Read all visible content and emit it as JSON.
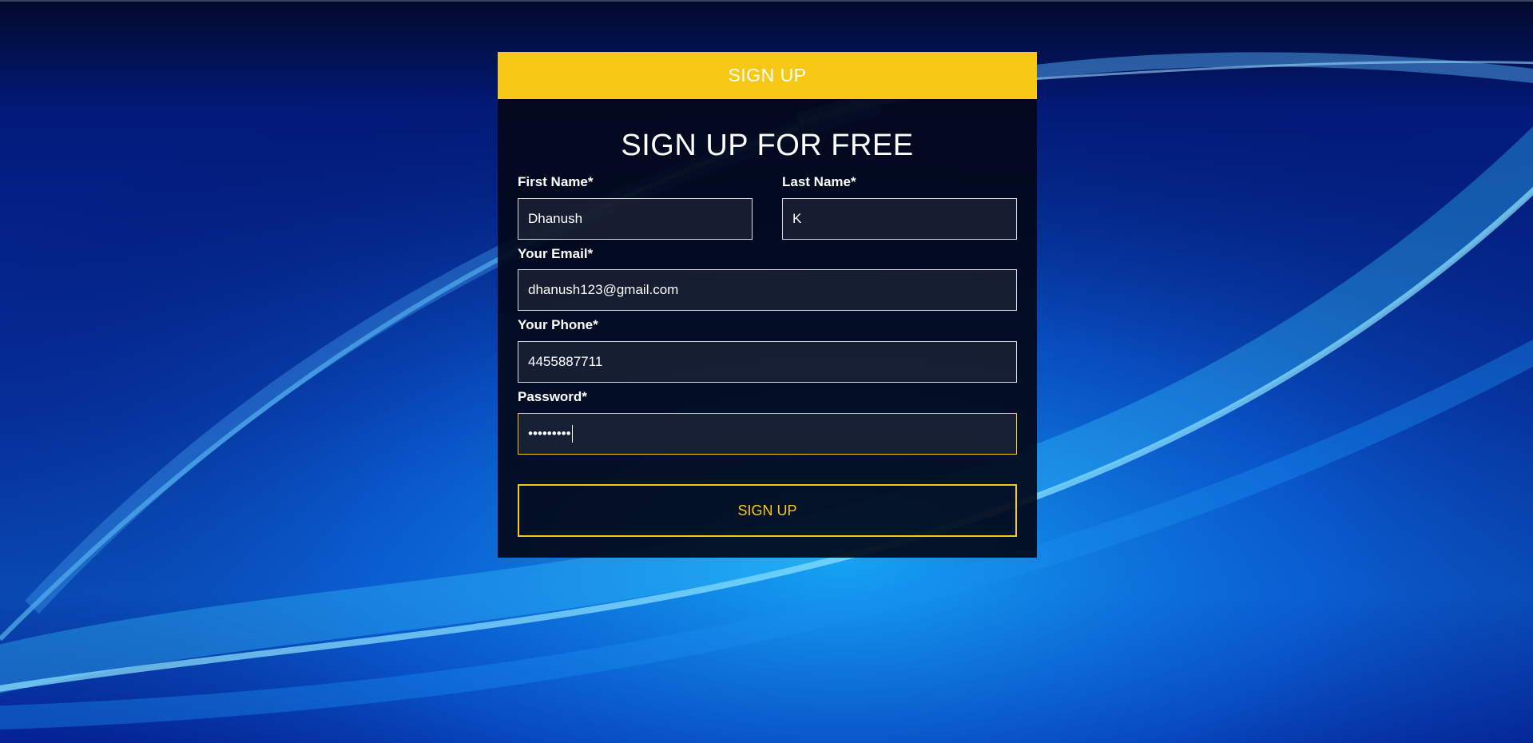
{
  "header": {
    "tab_label": "SIGN UP"
  },
  "form": {
    "title": "SIGN UP FOR FREE",
    "first_name": {
      "label": "First Name*",
      "value": "Dhanush"
    },
    "last_name": {
      "label": "Last Name*",
      "value": "K"
    },
    "email": {
      "label": "Your Email*",
      "value": "dhanush123@gmail.com"
    },
    "phone": {
      "label": "Your Phone*",
      "value": "4455887711"
    },
    "password": {
      "label": "Password*",
      "value": "•••••••••"
    },
    "submit_label": "SIGN UP"
  },
  "colors": {
    "accent": "#f7c916",
    "panel_bg": "#020818",
    "background": "#0a3fb5"
  }
}
